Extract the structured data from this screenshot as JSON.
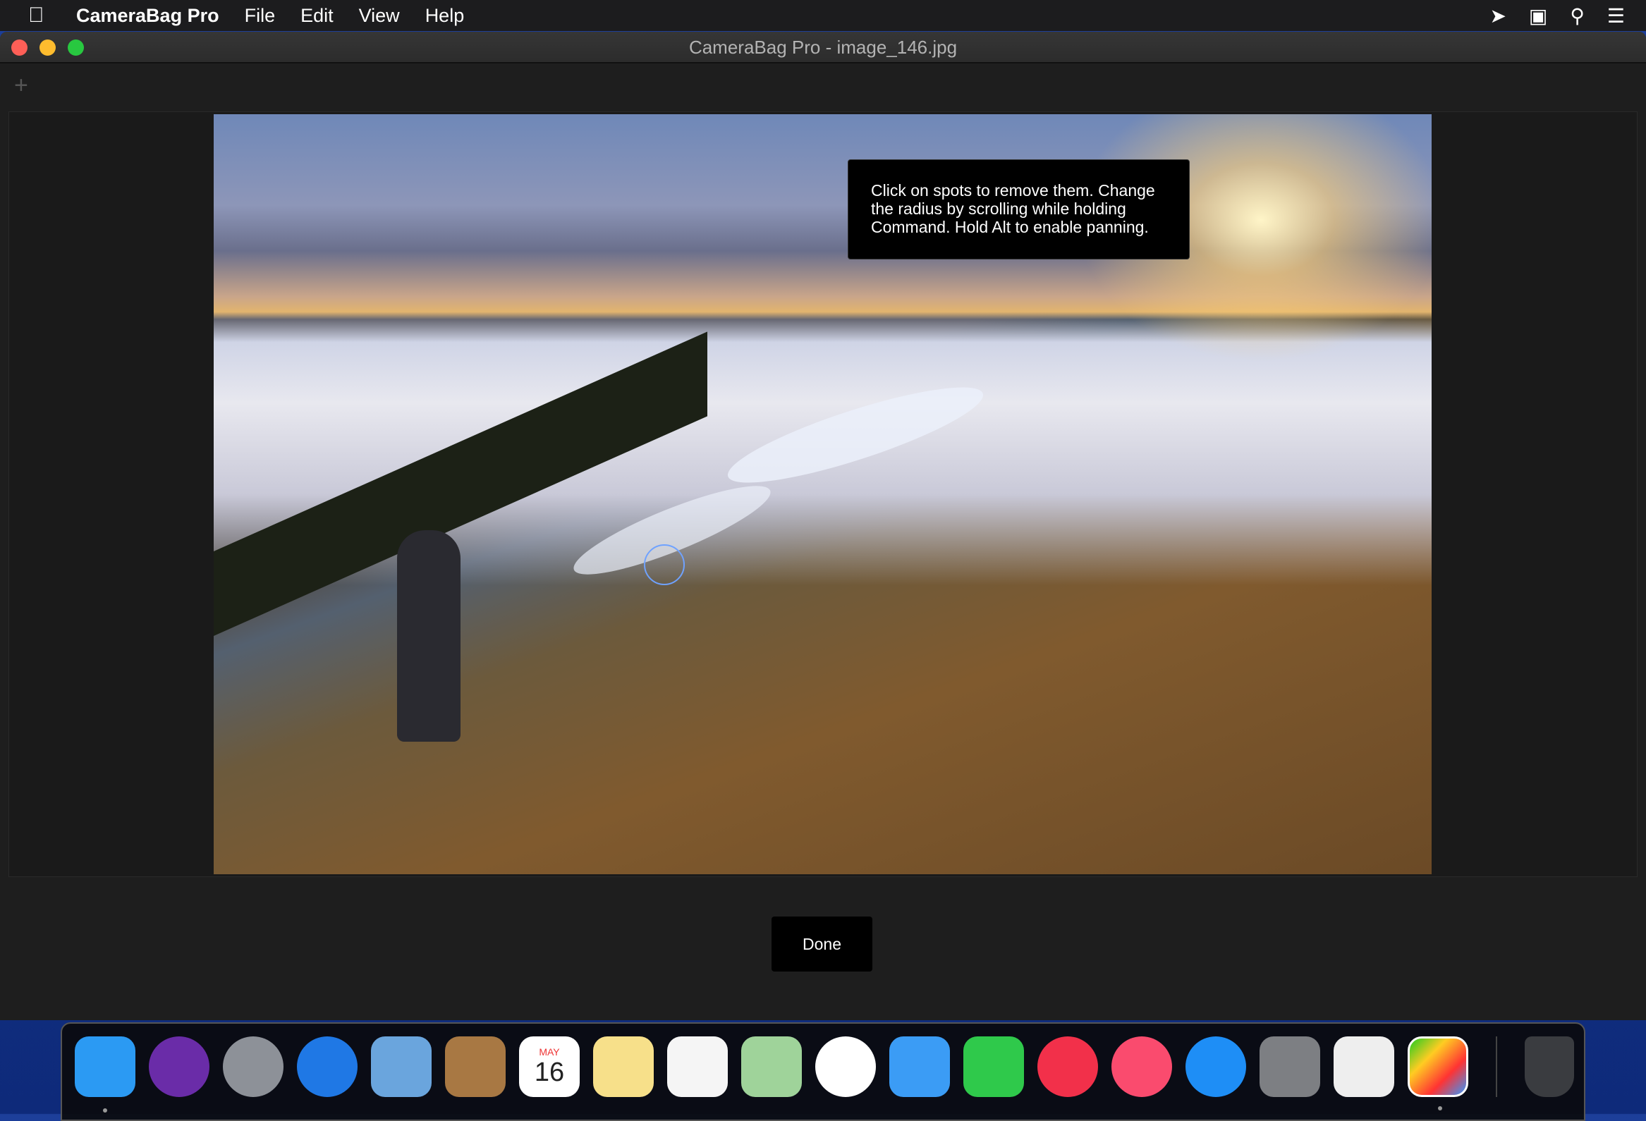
{
  "menubar": {
    "app_name": "CameraBag Pro",
    "items": [
      "File",
      "Edit",
      "View",
      "Help"
    ],
    "status_icons": [
      "airplay-cursor-icon",
      "screen-mirroring-icon",
      "search-icon",
      "control-center-list-icon"
    ]
  },
  "window": {
    "title": "CameraBag Pro - image_146.jpg",
    "add_label": "+"
  },
  "editor": {
    "tooltip": "Click on spots to remove them. Change the radius by scrolling while holding Command. Hold Alt to enable panning.",
    "done_label": "Done"
  },
  "dock": {
    "apps": [
      {
        "name": "finder",
        "color": "#2b9af3",
        "running": true
      },
      {
        "name": "siri",
        "color": "#6a2ca8"
      },
      {
        "name": "launchpad",
        "color": "#8d9198"
      },
      {
        "name": "safari",
        "color": "#1f78e5"
      },
      {
        "name": "mail",
        "color": "#6aa5dd"
      },
      {
        "name": "contacts",
        "color": "#a87843"
      },
      {
        "name": "calendar",
        "color": "#ffffff",
        "month": "MAY",
        "day": "16"
      },
      {
        "name": "notes",
        "color": "#f7e08a"
      },
      {
        "name": "reminders",
        "color": "#f5f5f5"
      },
      {
        "name": "maps",
        "color": "#9fd39a"
      },
      {
        "name": "photos",
        "color": "#ffffff"
      },
      {
        "name": "messages",
        "color": "#3b9cf5"
      },
      {
        "name": "facetime",
        "color": "#2fc94b"
      },
      {
        "name": "news",
        "color": "#f2304a"
      },
      {
        "name": "music",
        "color": "#fa4b6e"
      },
      {
        "name": "app-store",
        "color": "#1e8ef6"
      },
      {
        "name": "system-preferences",
        "color": "#7d7f83"
      },
      {
        "name": "textedit",
        "color": "#eeeeee"
      },
      {
        "name": "camerabag-pro",
        "color": "#1a1a1a",
        "running": true
      }
    ],
    "trash": {
      "name": "trash",
      "color": "#3a3c40"
    }
  }
}
